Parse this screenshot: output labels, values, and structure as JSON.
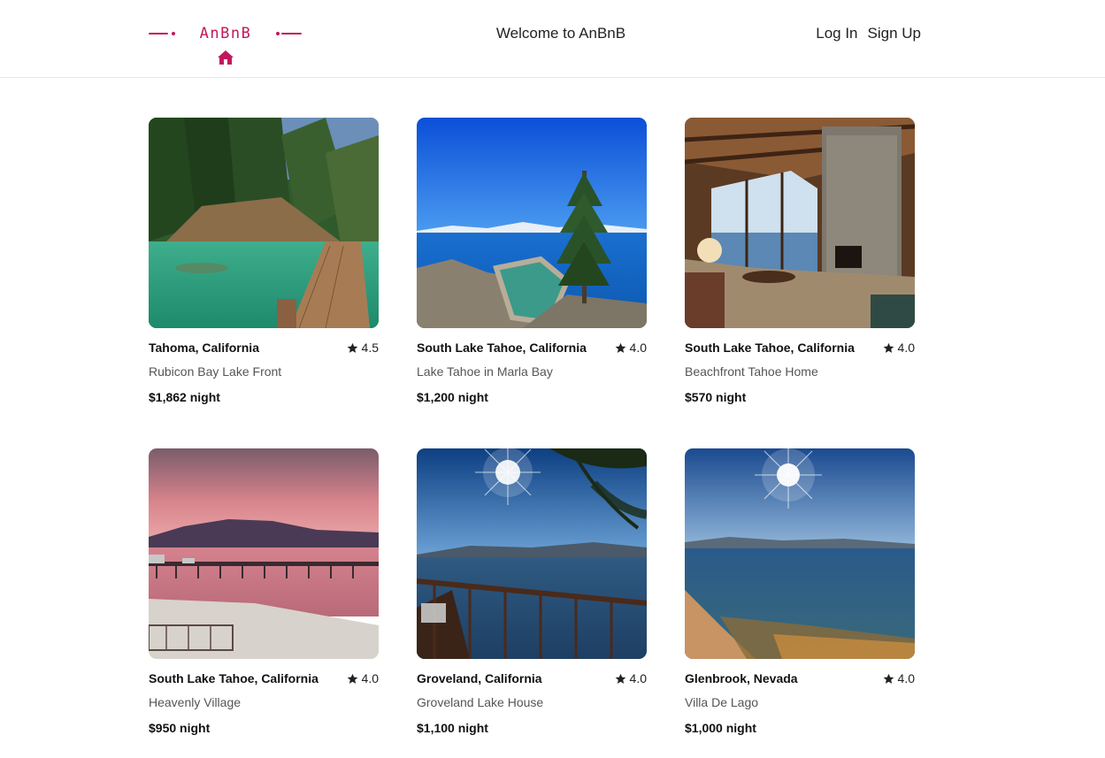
{
  "header": {
    "logo_text": "AnBnB",
    "welcome": "Welcome to AnBnB",
    "login_label": "Log In",
    "signup_label": "Sign Up",
    "brand_color": "#c2185b"
  },
  "listings": [
    {
      "location": "Tahoma, California",
      "rating": "4.5",
      "name": "Rubicon Bay Lake Front",
      "price": "$1,862 night",
      "photo": "lake-pier-pine-forest"
    },
    {
      "location": "South Lake Tahoe, California",
      "rating": "4.0",
      "name": "Lake Tahoe in Marla Bay",
      "price": "$1,200 night",
      "photo": "lake-rocky-shore-pine-tree"
    },
    {
      "location": "South Lake Tahoe, California",
      "rating": "4.0",
      "name": "Beachfront Tahoe Home",
      "price": "$570 night",
      "photo": "living-room-stone-fireplace"
    },
    {
      "location": "South Lake Tahoe, California",
      "rating": "4.0",
      "name": "Heavenly Village",
      "price": "$950 night",
      "photo": "pier-sunset-pink-sky"
    },
    {
      "location": "Groveland, California",
      "rating": "4.0",
      "name": "Groveland Lake House",
      "price": "$1,100 night",
      "photo": "lake-deck-railing-sun"
    },
    {
      "location": "Glenbrook, Nevada",
      "rating": "4.0",
      "name": "Villa De Lago",
      "price": "$1,000 night",
      "photo": "lake-shore-sun"
    }
  ]
}
